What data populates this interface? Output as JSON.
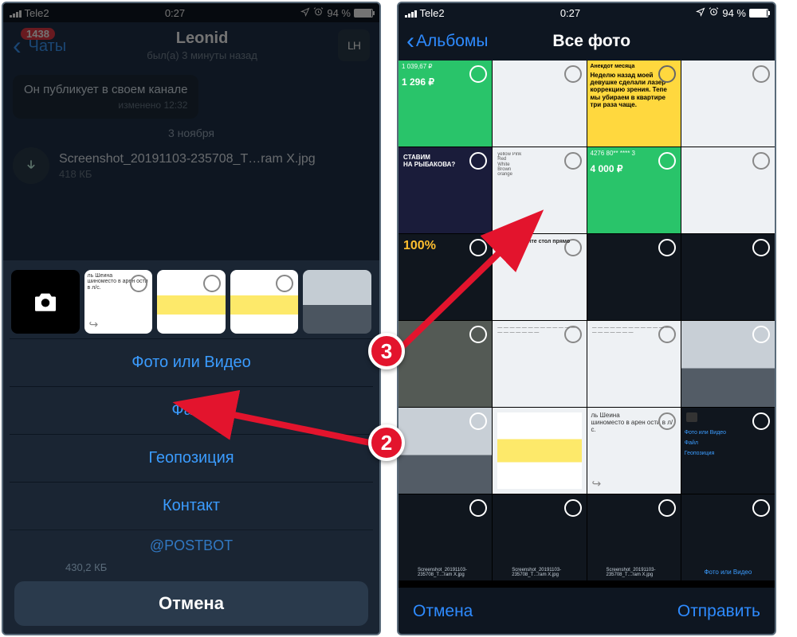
{
  "status": {
    "carrier": "Tele2",
    "time": "0:27",
    "battery_pct": "94 %"
  },
  "left": {
    "back_label": "Чаты",
    "unread_badge": "1438",
    "contact_name": "Leonid",
    "contact_status": "был(а) 3 минуты назад",
    "avatar_initials": "LH",
    "msg_text": "Он публикует в своем канале",
    "msg_edited": "изменено 12:32",
    "date": "3 ноября",
    "file_name": "Screenshot_20191103-235708_T…ram X.jpg",
    "file_size": "418 КБ",
    "trace_size": "430,2 КБ",
    "opts": {
      "photo": "Фото или Видео",
      "file": "Файл",
      "location": "Геопозиция",
      "contact": "Контакт",
      "postbot": "@POSTBOT"
    },
    "cancel": "Отмена"
  },
  "right": {
    "back": "Альбомы",
    "title": "Все фото",
    "cell_green1_head": "1 039,67 ₽",
    "cell_green1_amt": "1 296 ₽",
    "cell_green2_head": "4276 80** **** 3",
    "cell_green2_amt": "4 000 ₽",
    "yellow_head": "Анекдот месяца",
    "yellow_body": "Неделю назад моей девушке сделали лазер коррекцию зрения. Тепе мы убираем в квартире три раза чаще.",
    "doc_txt1": "ль Шеина",
    "doc_txt2": "шиноместо в арен ости в л/с.",
    "promo_pct": "100%",
    "promo_head": "Забронируйте стол прямо сейчас",
    "screenshot_caption": "Screenshot_20191103-235708_T…ram X.jpg",
    "mini_opts": {
      "photo": "Фото или Видео",
      "file": "Файл",
      "loc": "Геопозиция"
    },
    "bot_cancel": "Отмена",
    "bot_send": "Отправить"
  },
  "markers": {
    "two": "2",
    "three": "3"
  }
}
